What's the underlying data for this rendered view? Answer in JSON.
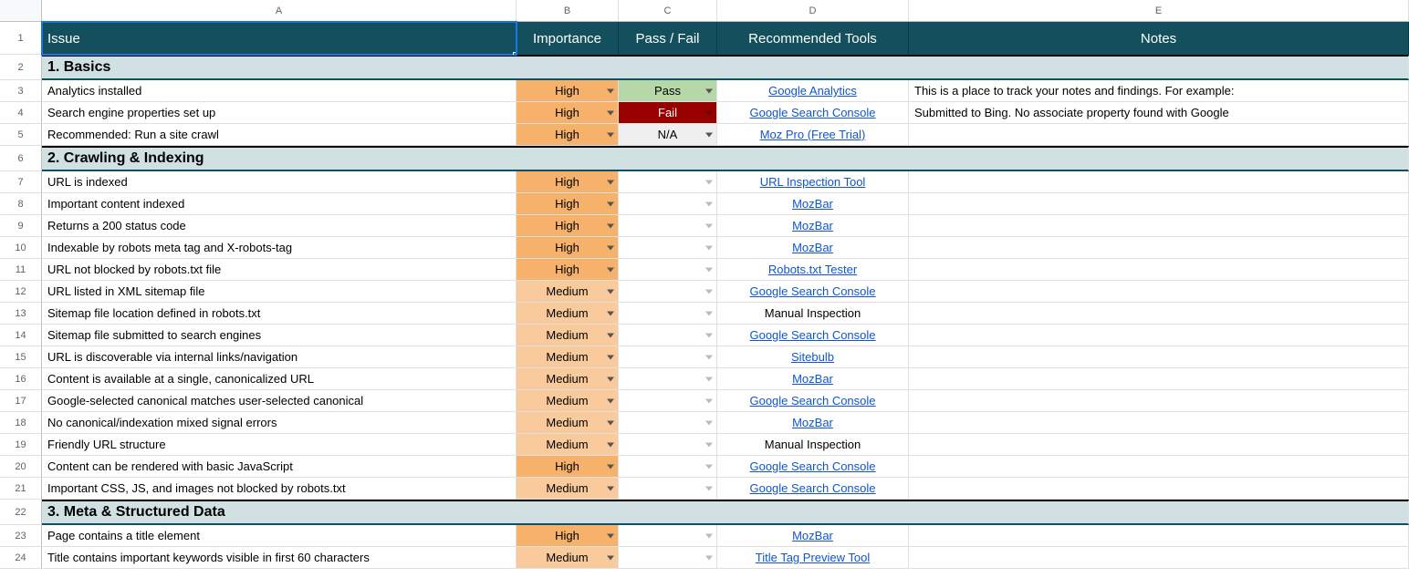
{
  "columns": [
    "A",
    "B",
    "C",
    "D",
    "E"
  ],
  "rowNumbers": [
    1,
    2,
    3,
    4,
    5,
    6,
    7,
    8,
    9,
    10,
    11,
    12,
    13,
    14,
    15,
    16,
    17,
    18,
    19,
    20,
    21,
    22,
    23,
    24
  ],
  "header": {
    "a": "Issue",
    "b": "Importance",
    "c": "Pass / Fail",
    "d": "Recommended Tools",
    "e": "Notes"
  },
  "sections": {
    "s1": "1. Basics",
    "s2": "2. Crawling & Indexing",
    "s3": "3. Meta & Structured Data"
  },
  "rows": {
    "r3": {
      "issue": "Analytics installed",
      "imp": "High",
      "pf": "Pass",
      "tool": "Google Analytics",
      "tool_link": true,
      "notes": "This is a place to track your notes and findings. For example:"
    },
    "r4": {
      "issue": "Search engine properties set up",
      "imp": "High",
      "pf": "Fail",
      "tool": "Google Search Console",
      "tool_link": true,
      "notes": "Submitted to Bing. No associate property found with Google"
    },
    "r5": {
      "issue": "Recommended: Run a site crawl",
      "imp": "High",
      "pf": "N/A",
      "tool": "Moz Pro (Free Trial)",
      "tool_link": true,
      "notes": ""
    },
    "r7": {
      "issue": "URL is indexed",
      "imp": "High",
      "pf": "",
      "tool": "URL Inspection Tool",
      "tool_link": true,
      "notes": ""
    },
    "r8": {
      "issue": "Important content indexed",
      "imp": "High",
      "pf": "",
      "tool": "MozBar",
      "tool_link": true,
      "notes": ""
    },
    "r9": {
      "issue": "Returns a 200 status code",
      "imp": "High",
      "pf": "",
      "tool": "MozBar",
      "tool_link": true,
      "notes": ""
    },
    "r10": {
      "issue": "Indexable by robots meta tag and X-robots-tag",
      "imp": "High",
      "pf": "",
      "tool": "MozBar",
      "tool_link": true,
      "notes": ""
    },
    "r11": {
      "issue": "URL not blocked by robots.txt file",
      "imp": "High",
      "pf": "",
      "tool": "Robots.txt Tester",
      "tool_link": true,
      "notes": ""
    },
    "r12": {
      "issue": "URL listed in XML sitemap file",
      "imp": "Medium",
      "pf": "",
      "tool": "Google Search Console",
      "tool_link": true,
      "notes": ""
    },
    "r13": {
      "issue": "Sitemap file location defined in robots.txt",
      "imp": "Medium",
      "pf": "",
      "tool": "Manual Inspection",
      "tool_link": false,
      "notes": ""
    },
    "r14": {
      "issue": "Sitemap file submitted to search engines",
      "imp": "Medium",
      "pf": "",
      "tool": "Google Search Console",
      "tool_link": true,
      "notes": ""
    },
    "r15": {
      "issue": "URL is discoverable via internal links/navigation",
      "imp": "Medium",
      "pf": "",
      "tool": "Sitebulb",
      "tool_link": true,
      "notes": ""
    },
    "r16": {
      "issue": "Content is available at a single, canonicalized URL",
      "imp": "Medium",
      "pf": "",
      "tool": "MozBar",
      "tool_link": true,
      "notes": ""
    },
    "r17": {
      "issue": "Google-selected canonical matches user-selected canonical",
      "imp": "Medium",
      "pf": "",
      "tool": "Google Search Console",
      "tool_link": true,
      "notes": ""
    },
    "r18": {
      "issue": "No canonical/indexation mixed signal errors",
      "imp": "Medium",
      "pf": "",
      "tool": "MozBar",
      "tool_link": true,
      "notes": ""
    },
    "r19": {
      "issue": "Friendly URL structure",
      "imp": "Medium",
      "pf": "",
      "tool": "Manual Inspection",
      "tool_link": false,
      "notes": ""
    },
    "r20": {
      "issue": "Content can be rendered with basic JavaScript",
      "imp": "High",
      "pf": "",
      "tool": "Google Search Console",
      "tool_link": true,
      "notes": ""
    },
    "r21": {
      "issue": "Important CSS, JS, and images not blocked by robots.txt",
      "imp": "Medium",
      "pf": "",
      "tool": "Google Search Console",
      "tool_link": true,
      "notes": ""
    },
    "r23": {
      "issue": "Page contains a title element",
      "imp": "High",
      "pf": "",
      "tool": "MozBar",
      "tool_link": true,
      "notes": ""
    },
    "r24": {
      "issue": "Title contains important keywords visible in first 60 characters",
      "imp": "Medium",
      "pf": "",
      "tool": "Title Tag Preview Tool",
      "tool_link": true,
      "notes": ""
    }
  }
}
